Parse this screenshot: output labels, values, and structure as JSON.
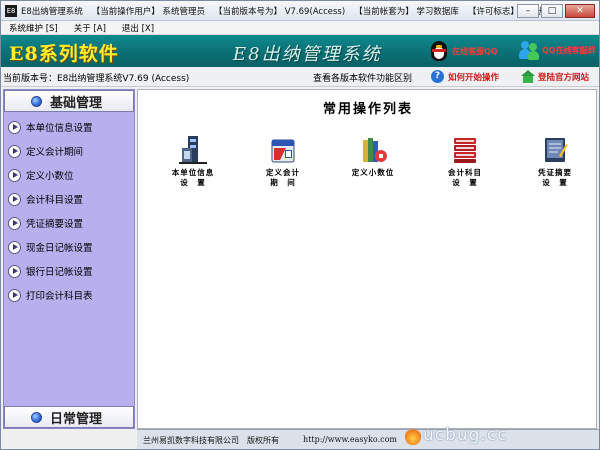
{
  "window": {
    "app_icon": "E8",
    "title_segments": [
      "E8出纳管理系统",
      "【当前操作用户】 系统管理员",
      "【当前版本号为】 V7.69(Access)",
      "【当前帐套为】 学习数据库",
      "【许可标志】 未注册版"
    ],
    "controls": {
      "minimize": "–",
      "maximize": "□",
      "close": "✕"
    }
  },
  "menu": [
    {
      "label": "系统维护 [S]"
    },
    {
      "label": "关于 [A]"
    },
    {
      "label": "退出 [X]"
    }
  ],
  "banner": {
    "brand": "E8系列软件",
    "system": "E8出纳管理系统",
    "qq_online": "在线客服QQ",
    "qq_group": "QQ在线客服群"
  },
  "version_strip": {
    "version_text": "当前版本号：E8出纳管理系统V7.69 (Access)",
    "view_diff": "查看各版本软件功能区别",
    "how_start": "如何开始操作",
    "official_site": "登陆官方网站"
  },
  "sidebar": {
    "basic_header": "基础管理",
    "items": [
      {
        "label": "本单位信息设置"
      },
      {
        "label": "定义会计期间"
      },
      {
        "label": "定义小数位"
      },
      {
        "label": "会计科目设置"
      },
      {
        "label": "凭证摘要设置"
      },
      {
        "label": "现金日记帐设置"
      },
      {
        "label": "银行日记帐设置"
      },
      {
        "label": "打印会计科目表"
      }
    ],
    "daily_header": "日常管理"
  },
  "main": {
    "title": "常用操作列表",
    "operations": [
      {
        "label": "本单位信息\n设　置",
        "icon": "building-info-icon"
      },
      {
        "label": "定义会计\n期　间",
        "icon": "calendar-period-icon"
      },
      {
        "label": "定义小数位",
        "icon": "decimal-books-icon"
      },
      {
        "label": "会计科目\n设　置",
        "icon": "ledger-stack-icon"
      },
      {
        "label": "凭证摘要\n设　置",
        "icon": "voucher-pen-icon"
      }
    ]
  },
  "footer": {
    "company": "兰州易凯数字科技有限公司",
    "rights": "版权所有",
    "url": "http://www.easyko.com"
  },
  "watermark": "ucbug.cc",
  "colors": {
    "banner": "#0f8a8e",
    "brand_text": "#ffef2a",
    "sidebar": "#b8b0ee",
    "link_red": "#d21a1a"
  }
}
